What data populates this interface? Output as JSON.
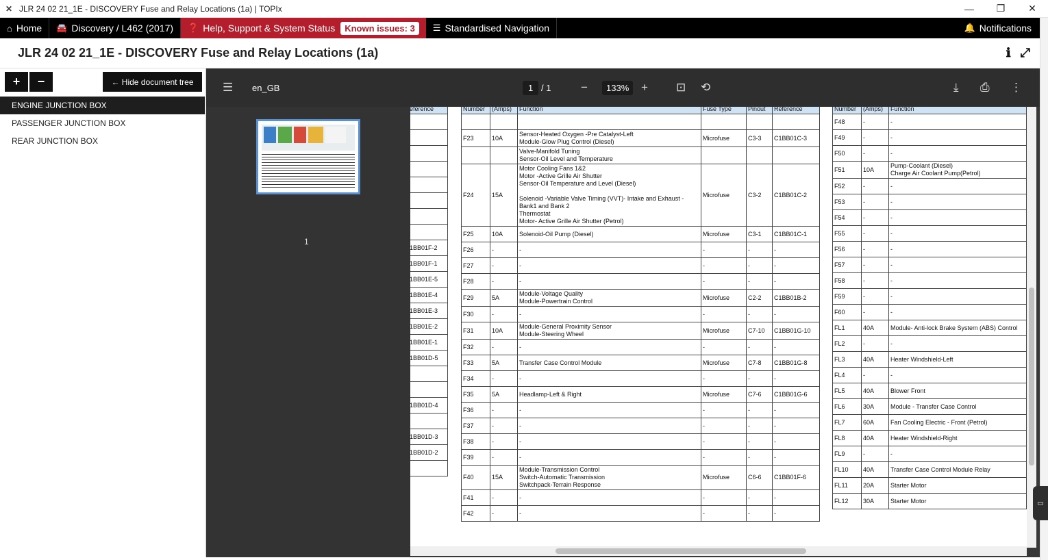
{
  "window": {
    "app_icon": "jlr-logo-icon",
    "title": "JLR 24 02 21_1E - DISCOVERY Fuse and Relay Locations (1a) | TOPIx",
    "minimize": "—",
    "maximize": "❐",
    "close": "✕"
  },
  "nav": {
    "home": "Home",
    "vehicle": "Discovery / L462 (2017)",
    "help": "Help, Support & System Status",
    "known_issues": "Known issues: 3",
    "standardised": "Standardised Navigation",
    "notifications": "Notifications"
  },
  "doc": {
    "title": "JLR 24 02 21_1E - DISCOVERY Fuse and Relay Locations (1a)"
  },
  "tree": {
    "expand": "+",
    "collapse": "−",
    "hide_label": "←  Hide document tree",
    "items": [
      "ENGINE JUNCTION BOX",
      "PASSENGER JUNCTION BOX",
      "REAR JUNCTION BOX"
    ]
  },
  "viewer": {
    "language": "en_GB",
    "page_current": "1",
    "page_total": "/ 1",
    "zoom": "133%",
    "thumb_number": "1"
  },
  "table_left": {
    "headers": [
      "eference"
    ],
    "rows": [
      "",
      "",
      "",
      "",
      "",
      "",
      "",
      "",
      "1BB01F-2",
      "1BB01F-1",
      "1BB01E-5",
      "1BB01E-4",
      "1BB01E-3",
      "1BB01E-2",
      "1BB01E-1",
      "1BB01D-5",
      "",
      "",
      "1BB01D-4",
      "",
      "1BB01D-3",
      "1BB01D-2",
      ""
    ]
  },
  "table_mid": {
    "headers": [
      "Number",
      "(Amps)",
      "Function",
      "Fuse Type",
      "Pinout",
      "Reference"
    ],
    "rows": [
      {
        "num": "",
        "amp": "",
        "fn": "",
        "type": "",
        "pin": "",
        "ref": ""
      },
      {
        "num": "F23",
        "amp": "10A",
        "fn": "Sensor-Heated Oxygen -Pre Catalyst-Left\nModule-Glow Plug Control (Diesel)",
        "type": "Microfuse",
        "pin": "C3-3",
        "ref": "C1BB01C-3"
      },
      {
        "num": "",
        "amp": "",
        "fn": "Valve-Manifold Tuning\nSensor-Oil Level and Temperature",
        "type": "",
        "pin": "",
        "ref": ""
      },
      {
        "num": "F24",
        "amp": "15A",
        "fn": "Motor Cooling Fans 1&2\nMotor -Active Grille Air Shutter\nSensor-Oil Temperature  and Level (Diesel)\n\nSolenoid -Variable Valve Timing (VVT)- Intake and Exhaust -\nBank1 and Bank 2\nThermostat\nMotor- Active Grille Air Shutter (Petrol)",
        "type": "Microfuse",
        "pin": "C3-2",
        "ref": "C1BB01C-2"
      },
      {
        "num": "F25",
        "amp": "10A",
        "fn": "Solenoid-Oil Pump (Diesel)",
        "type": "Microfuse",
        "pin": "C3-1",
        "ref": "C1BB01C-1"
      },
      {
        "num": "F26",
        "amp": "-",
        "fn": "-",
        "type": "-",
        "pin": "-",
        "ref": "-"
      },
      {
        "num": "F27",
        "amp": "-",
        "fn": "-",
        "type": "-",
        "pin": "-",
        "ref": "-"
      },
      {
        "num": "F28",
        "amp": "-",
        "fn": "-",
        "type": "-",
        "pin": "-",
        "ref": "-"
      },
      {
        "num": "F29",
        "amp": "5A",
        "fn": "Module-Voltage Quality\nModule-Powertrain Control",
        "type": "Microfuse",
        "pin": "C2-2",
        "ref": "C1BB01B-2"
      },
      {
        "num": "F30",
        "amp": "-",
        "fn": "-",
        "type": "-",
        "pin": "-",
        "ref": "-"
      },
      {
        "num": "F31",
        "amp": "10A",
        "fn": "Module-General Proximity Sensor\nModule-Steering Wheel",
        "type": "Microfuse",
        "pin": "C7-10",
        "ref": "C1BB01G-10"
      },
      {
        "num": "F32",
        "amp": "-",
        "fn": "-",
        "type": "-",
        "pin": "-",
        "ref": "-"
      },
      {
        "num": "F33",
        "amp": "5A",
        "fn": "Transfer Case Control Module",
        "type": "Microfuse",
        "pin": "C7-8",
        "ref": "C1BB01G-8"
      },
      {
        "num": "F34",
        "amp": "-",
        "fn": "-",
        "type": "-",
        "pin": "-",
        "ref": "-"
      },
      {
        "num": "F35",
        "amp": "5A",
        "fn": "Headlamp-Left & Right",
        "type": "Microfuse",
        "pin": "C7-6",
        "ref": "C1BB01G-6"
      },
      {
        "num": "F36",
        "amp": "-",
        "fn": "-",
        "type": "-",
        "pin": "-",
        "ref": "-"
      },
      {
        "num": "F37",
        "amp": "-",
        "fn": "-",
        "type": "-",
        "pin": "-",
        "ref": "-"
      },
      {
        "num": "F38",
        "amp": "-",
        "fn": "-",
        "type": "-",
        "pin": "-",
        "ref": "-"
      },
      {
        "num": "F39",
        "amp": "-",
        "fn": "-",
        "type": "-",
        "pin": "-",
        "ref": "-"
      },
      {
        "num": "F40",
        "amp": "15A",
        "fn": "Module-Transmission Control\nSwitch-Automatic Transmission\nSwitchpack-Terrain Response",
        "type": "Microfuse",
        "pin": "C6-6",
        "ref": "C1BB01F-6"
      },
      {
        "num": "F41",
        "amp": "-",
        "fn": "-",
        "type": "-",
        "pin": "-",
        "ref": "-"
      },
      {
        "num": "F42",
        "amp": "-",
        "fn": "-",
        "type": "-",
        "pin": "-",
        "ref": "-"
      }
    ]
  },
  "table_right": {
    "headers": [
      "Number",
      "(Amps)",
      "Function"
    ],
    "rows": [
      {
        "num": "F48",
        "amp": "-",
        "fn": "-"
      },
      {
        "num": "F49",
        "amp": "-",
        "fn": "-"
      },
      {
        "num": "F50",
        "amp": "-",
        "fn": "-"
      },
      {
        "num": "F51",
        "amp": "10A",
        "fn": "Pump-Coolant (Diesel)\nCharge Air Coolant Pump(Petrol)"
      },
      {
        "num": "F52",
        "amp": "-",
        "fn": "-"
      },
      {
        "num": "F53",
        "amp": "-",
        "fn": "-"
      },
      {
        "num": "F54",
        "amp": "-",
        "fn": "-"
      },
      {
        "num": "F55",
        "amp": "-",
        "fn": "-"
      },
      {
        "num": "F56",
        "amp": "-",
        "fn": "-"
      },
      {
        "num": "F57",
        "amp": "-",
        "fn": "-"
      },
      {
        "num": "F58",
        "amp": "-",
        "fn": "-"
      },
      {
        "num": "F59",
        "amp": "-",
        "fn": "-"
      },
      {
        "num": "F60",
        "amp": "-",
        "fn": "-"
      },
      {
        "num": "FL1",
        "amp": "40A",
        "fn": "Module- Anti-lock Brake System (ABS) Control"
      },
      {
        "num": "FL2",
        "amp": "-",
        "fn": "-"
      },
      {
        "num": "FL3",
        "amp": "40A",
        "fn": "Heater Windshield-Left"
      },
      {
        "num": "FL4",
        "amp": "-",
        "fn": "-"
      },
      {
        "num": "FL5",
        "amp": "40A",
        "fn": "Blower Front"
      },
      {
        "num": "FL6",
        "amp": "30A",
        "fn": " Module - Transfer Case Control"
      },
      {
        "num": "FL7",
        "amp": "60A",
        "fn": "Fan Cooling Electric - Front (Petrol)"
      },
      {
        "num": "FL8",
        "amp": "40A",
        "fn": "Heater Windshield-Right"
      },
      {
        "num": "FL9",
        "amp": "-",
        "fn": "-"
      },
      {
        "num": "FL10",
        "amp": "40A",
        "fn": "Transfer Case Control Module Relay"
      },
      {
        "num": "FL11",
        "amp": "20A",
        "fn": "Starter Motor"
      },
      {
        "num": "FL12",
        "amp": "30A",
        "fn": "Starter Motor"
      }
    ]
  },
  "icons": {
    "home": "home-icon",
    "car": "car-icon",
    "help": "question-icon",
    "list": "list-icon",
    "bell": "bell-icon",
    "info": "info-icon",
    "fullscreen": "expand-icon",
    "menu": "hamburger-icon",
    "zoom_out": "minus-icon",
    "zoom_in": "plus-icon",
    "fit": "fit-page-icon",
    "rotate": "rotate-icon",
    "download": "download-icon",
    "print": "print-icon",
    "more": "more-vert-icon"
  }
}
